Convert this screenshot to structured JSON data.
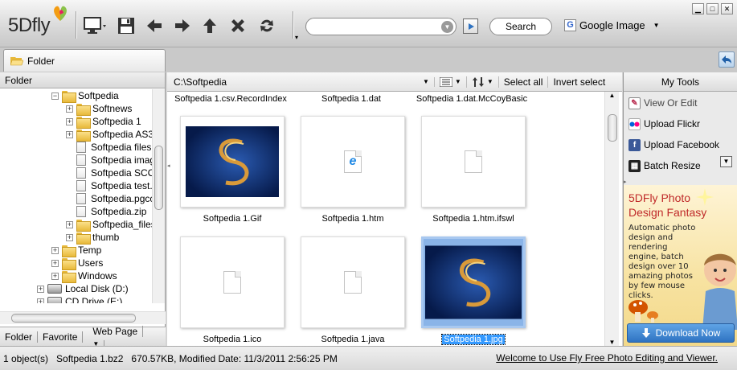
{
  "app": {
    "logo_text": "5Dfly"
  },
  "toolbar": {
    "search_label": "Search",
    "engine_label": "Google Image"
  },
  "tabs": {
    "folder_tab": "Folder"
  },
  "left_panel": {
    "header": "Folder",
    "tree": [
      {
        "label": "Softpedia",
        "type": "folder",
        "expanded": true
      },
      {
        "label": "Softnews",
        "type": "folder"
      },
      {
        "label": "Softpedia 1",
        "type": "folder"
      },
      {
        "label": "Softpedia AS3",
        "type": "folder"
      },
      {
        "label": "Softpedia files.",
        "type": "file"
      },
      {
        "label": "Softpedia imag",
        "type": "file"
      },
      {
        "label": "Softpedia SCO",
        "type": "file"
      },
      {
        "label": "Softpedia test.",
        "type": "file"
      },
      {
        "label": "Softpedia.pgcc",
        "type": "file"
      },
      {
        "label": "Softpedia.zip",
        "type": "file"
      },
      {
        "label": "Softpedia_files",
        "type": "folder"
      },
      {
        "label": "thumb",
        "type": "folder"
      },
      {
        "label": "Temp",
        "type": "folder"
      },
      {
        "label": "Users",
        "type": "folder"
      },
      {
        "label": "Windows",
        "type": "folder"
      },
      {
        "label": "Local Disk (D:)",
        "type": "drive"
      },
      {
        "label": "CD Drive (E:)",
        "type": "drive"
      }
    ],
    "bottom_tabs": [
      "Folder",
      "Favorite",
      "Web Page"
    ]
  },
  "content": {
    "path": "C:\\Softpedia",
    "select_all": "Select all",
    "invert_select": "Invert select",
    "top_labels": [
      "Softpedia 1.csv.RecordIndex",
      "Softpedia 1.dat",
      "Softpedia 1.dat.McCoyBasic"
    ],
    "files": [
      {
        "name": "Softpedia 1.Gif",
        "kind": "image"
      },
      {
        "name": "Softpedia 1.htm",
        "kind": "ie"
      },
      {
        "name": "Softpedia 1.htm.ifswl",
        "kind": "doc"
      },
      {
        "name": "Softpedia 1.ico",
        "kind": "doc"
      },
      {
        "name": "Softpedia 1.java",
        "kind": "doc"
      },
      {
        "name": "Softpedia 1.jpg",
        "kind": "image",
        "selected": true
      }
    ]
  },
  "right_panel": {
    "header": "My Tools",
    "items": [
      "View Or Edit",
      "Upload Flickr",
      "Upload Facebook",
      "Batch Resize"
    ],
    "ad": {
      "title1": "5DFly Photo",
      "title2": "Design Fantasy",
      "body": "Automatic photo design and rendering engine, batch design over 10 amazing photos by few mouse clicks.",
      "download": "Download Now"
    }
  },
  "status": {
    "count": "1 object(s)",
    "file_info": "Softpedia 1.bz2   670.57KB, Modified Date: 11/3/2011 2:56:25 PM",
    "welcome": "Welcome to Use Fly Free Photo Editing and Viewer."
  },
  "colors": {
    "selection": "#3399ff",
    "ad_title": "#c02a2a",
    "download_btn": "#2f73c2"
  }
}
